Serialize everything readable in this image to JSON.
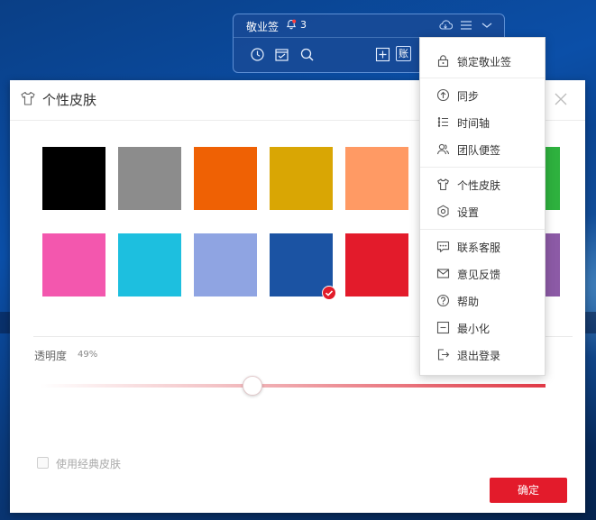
{
  "widget": {
    "title": "敬业签",
    "notification_count": "3",
    "account_label": "账"
  },
  "dialog": {
    "title": "个性皮肤",
    "swatches_row1": [
      "#000000",
      "#8c8c8c",
      "#ef6104",
      "#d9a604",
      "#ff9a64",
      "#ffffff",
      "#2eb13e"
    ],
    "swatches_row2": [
      "#f357ae",
      "#1dbfdf",
      "#8fa4e2",
      "#1b53a3",
      "#e31b2b",
      "#ffffff",
      "#8c5aa6"
    ],
    "selected_swatch": "#1b53a3",
    "opacity_label": "透明度",
    "opacity_value": "49%",
    "opacity_level": 0.49,
    "classic_skin_label": "使用经典皮肤",
    "confirm_label": "确定"
  },
  "menu": {
    "group1": [
      {
        "label": "锁定敬业签",
        "icon": "lock-icon"
      }
    ],
    "group2": [
      {
        "label": "同步",
        "icon": "sync-arrow-icon"
      },
      {
        "label": "时间轴",
        "icon": "timeline-icon"
      },
      {
        "label": "团队便签",
        "icon": "team-icon"
      }
    ],
    "group3": [
      {
        "label": "个性皮肤",
        "icon": "shirt-icon"
      },
      {
        "label": "设置",
        "icon": "hexagon-settings-icon"
      }
    ],
    "group4": [
      {
        "label": "联系客服",
        "icon": "chat-icon"
      },
      {
        "label": "意见反馈",
        "icon": "mail-icon"
      },
      {
        "label": "帮助",
        "icon": "help-icon"
      },
      {
        "label": "最小化",
        "icon": "minimize-icon"
      },
      {
        "label": "退出登录",
        "icon": "logout-icon"
      }
    ]
  },
  "colors": {
    "accent": "#e31b2b",
    "widget_bg": "#184a96"
  }
}
